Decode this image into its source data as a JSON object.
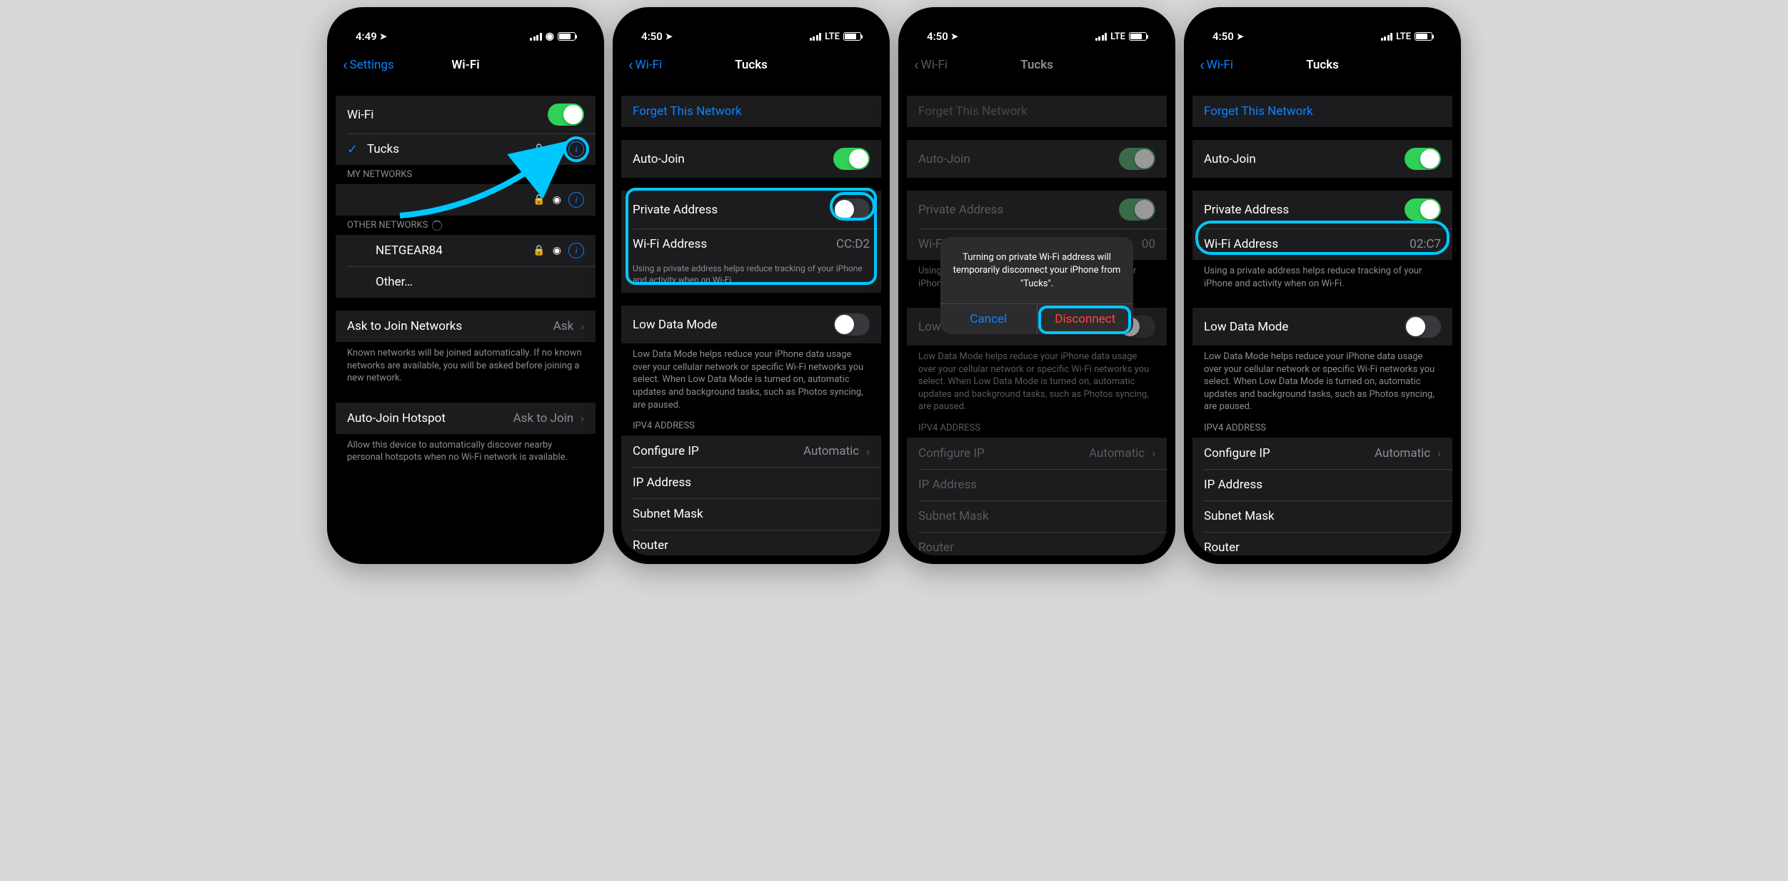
{
  "s1": {
    "time": "4:49",
    "signal": "wifi",
    "back": "Settings",
    "title": "Wi-Fi",
    "wifi_label": "Wi-Fi",
    "wifi_on": true,
    "connected": "Tucks",
    "my_networks": "MY NETWORKS",
    "other_networks": "OTHER NETWORKS",
    "netgear": "NETGEAR84",
    "other": "Other…",
    "ask": "Ask to Join Networks",
    "ask_val": "Ask",
    "ask_foot": "Known networks will be joined automatically. If no known networks are available, you will be asked before joining a new network.",
    "hotspot": "Auto-Join Hotspot",
    "hotspot_val": "Ask to Join",
    "hotspot_foot": "Allow this device to automatically discover nearby personal hotspots when no Wi-Fi network is available."
  },
  "s2": {
    "time": "4:50",
    "signal": "LTE",
    "back": "Wi-Fi",
    "title": "Tucks",
    "forget": "Forget This Network",
    "autojoin": "Auto-Join",
    "priv": "Private Address",
    "wifi_addr_label": "Wi-Fi Address",
    "wifi_addr": "CC:D2",
    "priv_foot": "Using a private address helps reduce tracking of your iPhone and activity when on Wi-Fi.",
    "low": "Low Data Mode",
    "low_foot": "Low Data Mode helps reduce your iPhone data usage over your cellular network or specific Wi-Fi networks you select. When Low Data Mode is turned on, automatic updates and background tasks, such as Photos syncing, are paused.",
    "ipv4": "IPV4 ADDRESS",
    "cfg": "Configure IP",
    "auto": "Automatic",
    "ip": "IP Address",
    "subnet": "Subnet Mask",
    "router": "Router",
    "priv_on": false
  },
  "s3": {
    "time": "4:50",
    "signal": "LTE",
    "back": "Wi-Fi",
    "title": "Tucks",
    "wifi_addr": "00",
    "alert": "Turning on private Wi-Fi address will temporarily disconnect your iPhone from \"Tucks\".",
    "cancel": "Cancel",
    "disconnect": "Disconnect"
  },
  "s4": {
    "time": "4:50",
    "signal": "LTE",
    "back": "Wi-Fi",
    "title": "Tucks",
    "wifi_addr": "02:C7",
    "priv_on": true
  }
}
